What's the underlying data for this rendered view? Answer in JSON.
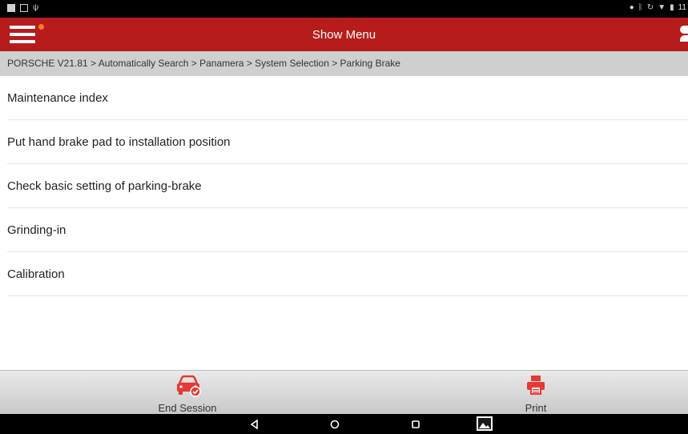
{
  "status_bar": {
    "time": "11",
    "left_icons": [
      "notification-icon",
      "message-icon",
      "usb-icon"
    ],
    "right_icons": [
      "location-icon",
      "bluetooth-icon",
      "sync-icon",
      "wifi-icon",
      "battery-icon"
    ]
  },
  "header": {
    "title": "Show Menu",
    "menu_icon": "hamburger-menu-icon",
    "user_icon": "user-icon"
  },
  "breadcrumb": {
    "text": "PORSCHE V21.81 > Automatically Search > Panamera > System Selection > Parking Brake"
  },
  "menu": {
    "items": [
      {
        "label": "Maintenance index"
      },
      {
        "label": "Put hand brake pad to installation position"
      },
      {
        "label": "Check basic setting of parking-brake"
      },
      {
        "label": "Grinding-in"
      },
      {
        "label": "Calibration"
      }
    ]
  },
  "toolbar": {
    "end_session_label": "End Session",
    "print_label": "Print",
    "end_session_icon": "car-check-icon",
    "print_icon": "printer-icon"
  },
  "nav_bar": {
    "icons": [
      "back-icon",
      "home-icon",
      "recent-apps-icon",
      "gallery-icon"
    ]
  },
  "colors": {
    "header_bg": "#b71c1c",
    "accent_icon": "#e53935",
    "menu_notification_dot": "#ff7a2a",
    "breadcrumb_bg": "#cfcfcf"
  }
}
